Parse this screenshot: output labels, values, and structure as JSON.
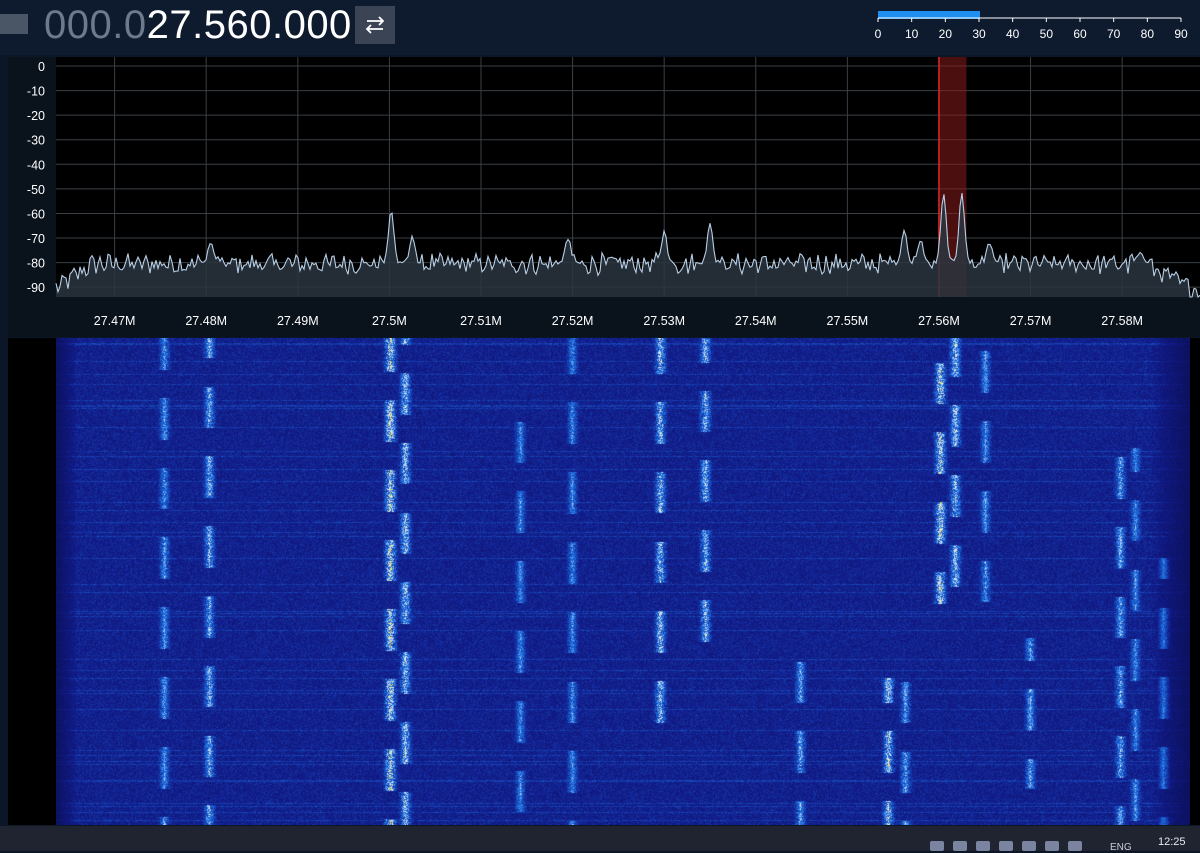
{
  "frequency": {
    "dim_digits": "000.0",
    "main_digits": "27.560.000"
  },
  "swap_button": {
    "icon": "swap-arrows-icon"
  },
  "level_meter": {
    "ticks": [
      "0",
      "10",
      "20",
      "30",
      "40",
      "50",
      "60",
      "70",
      "80",
      "90"
    ],
    "fill_percent": 33.7,
    "color": "#1e8ef0"
  },
  "spectrum": {
    "y_ticks": [
      "0",
      "-10",
      "-20",
      "-30",
      "-40",
      "-50",
      "-60",
      "-70",
      "-80",
      "-90"
    ],
    "y_range": [
      -94,
      0
    ],
    "x_ticks": [
      "27.47M",
      "27.48M",
      "27.49M",
      "27.5M",
      "27.51M",
      "27.52M",
      "27.53M",
      "27.54M",
      "27.55M",
      "27.56M",
      "27.57M",
      "27.58M"
    ],
    "x_range_mhz": [
      27.4636,
      27.5885
    ],
    "tuned_mhz": 27.56,
    "bandwidth_mhz": 0.003,
    "peaks": [
      {
        "mhz": 27.4805,
        "db": -72
      },
      {
        "mhz": 27.5002,
        "db": -59
      },
      {
        "mhz": 27.5025,
        "db": -70
      },
      {
        "mhz": 27.5195,
        "db": -70
      },
      {
        "mhz": 27.53,
        "db": -67
      },
      {
        "mhz": 27.535,
        "db": -63
      },
      {
        "mhz": 27.5562,
        "db": -67
      },
      {
        "mhz": 27.558,
        "db": -71
      },
      {
        "mhz": 27.5605,
        "db": -51
      },
      {
        "mhz": 27.5625,
        "db": -51
      },
      {
        "mhz": 27.5655,
        "db": -72
      },
      {
        "mhz": 27.582,
        "db": -75
      }
    ],
    "colors": {
      "trace": "#b8cfe6",
      "fill": "#2a3540",
      "grid": "#3a3f46",
      "passband": "#8a1c1c",
      "tuned_line": "#e02828"
    }
  },
  "taskbar": {
    "language": "ENG",
    "clock": "12:25"
  }
}
